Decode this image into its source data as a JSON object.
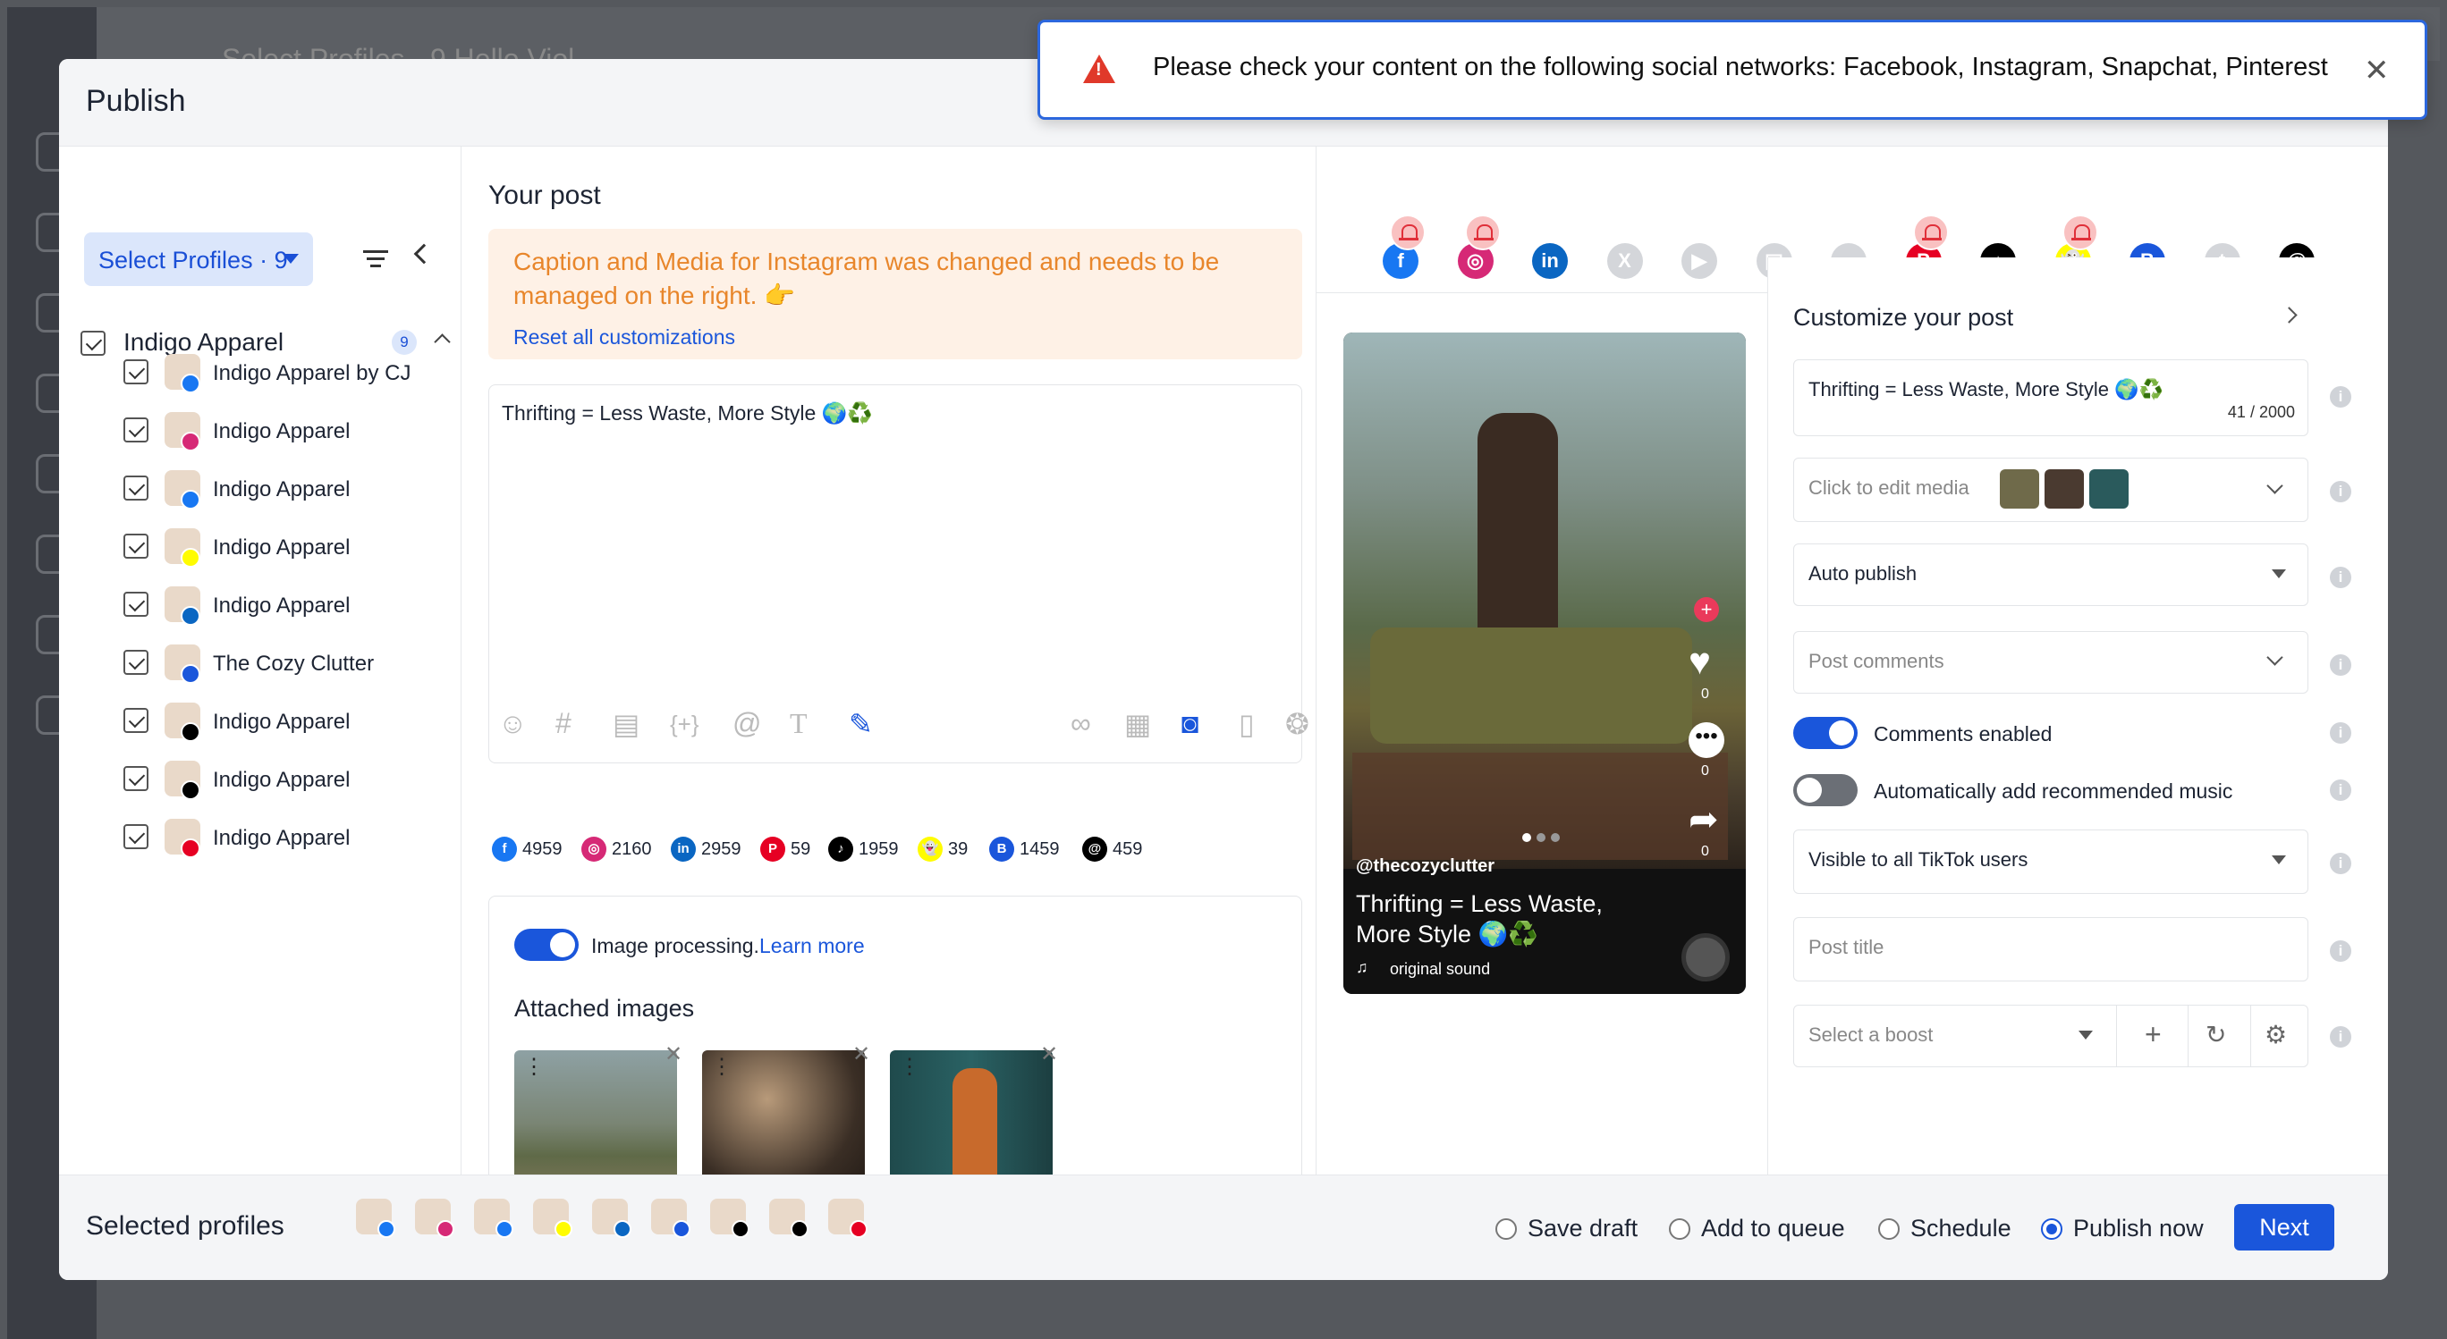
{
  "background": {
    "top_note": "Select Profiles · 9   Hello Viol"
  },
  "modal": {
    "title": "Publish"
  },
  "toast": {
    "message": "Please check your content on the following social networks: Facebook, Instagram, Snapchat, Pinterest",
    "close": "✕"
  },
  "left": {
    "select_profiles": "Select Profiles · 9",
    "group": {
      "name": "Indigo Apparel",
      "count": "9"
    },
    "profiles": [
      {
        "label": "Indigo Apparel by CJ",
        "network": "facebook",
        "color": "#1877f2"
      },
      {
        "label": "Indigo Apparel",
        "network": "instagram",
        "color": "#d62976"
      },
      {
        "label": "Indigo Apparel",
        "network": "facebook",
        "color": "#1877f2"
      },
      {
        "label": "Indigo Apparel",
        "network": "snapchat",
        "color": "#fffc00"
      },
      {
        "label": "Indigo Apparel",
        "network": "linkedin",
        "color": "#0a66c2"
      },
      {
        "label": "The Cozy Clutter",
        "network": "google-business",
        "color": "#1a56db"
      },
      {
        "label": "Indigo Apparel",
        "network": "threads",
        "color": "#000000"
      },
      {
        "label": "Indigo Apparel",
        "network": "tiktok",
        "color": "#000000"
      },
      {
        "label": "Indigo Apparel",
        "network": "pinterest",
        "color": "#e60023"
      }
    ]
  },
  "center": {
    "heading": "Your post",
    "warning": "Caption and Media for Instagram was changed and needs to be managed on the right. 👉",
    "reset": "Reset all customizations",
    "post_text": "Thrifting = Less Waste, More Style 🌍♻️",
    "counts": [
      {
        "network": "facebook",
        "glyph": "f",
        "color": "#1877f2",
        "value": "4959"
      },
      {
        "network": "instagram",
        "glyph": "◎",
        "color": "#d62976",
        "value": "2160"
      },
      {
        "network": "linkedin",
        "glyph": "in",
        "color": "#0a66c2",
        "value": "2959"
      },
      {
        "network": "pinterest",
        "glyph": "P",
        "color": "#e60023",
        "value": "59"
      },
      {
        "network": "tiktok",
        "glyph": "♪",
        "color": "#000000",
        "value": "1959"
      },
      {
        "network": "snapchat",
        "glyph": "👻",
        "color": "#fffc00",
        "value": "39"
      },
      {
        "network": "google-business",
        "glyph": "B",
        "color": "#1a56db",
        "value": "1459"
      },
      {
        "network": "threads",
        "glyph": "@",
        "color": "#000000",
        "value": "459"
      }
    ],
    "image_processing": "Image processing.",
    "learn_more": "Learn more",
    "attached_images": "Attached images"
  },
  "networks_bar": [
    {
      "name": "facebook",
      "glyph": "f",
      "color": "#1877f2",
      "alert": true
    },
    {
      "name": "instagram",
      "glyph": "◎",
      "color": "#d62976",
      "alert": true
    },
    {
      "name": "linkedin",
      "glyph": "in",
      "color": "#0a66c2",
      "alert": false
    },
    {
      "name": "x",
      "glyph": "X",
      "color": "#d4d6da",
      "alert": false
    },
    {
      "name": "youtube",
      "glyph": "▶",
      "color": "#d4d6da",
      "alert": false
    },
    {
      "name": "google-my-business",
      "glyph": "▤",
      "color": "#d4d6da",
      "alert": false
    },
    {
      "name": "reddit",
      "glyph": "●",
      "color": "#d4d6da",
      "alert": false
    },
    {
      "name": "pinterest",
      "glyph": "P",
      "color": "#e60023",
      "alert": true
    },
    {
      "name": "tiktok",
      "glyph": "♪",
      "color": "#000000",
      "alert": false
    },
    {
      "name": "snapchat",
      "glyph": "👻",
      "color": "#fffc00",
      "alert": true
    },
    {
      "name": "google-business",
      "glyph": "B",
      "color": "#1a56db",
      "alert": false
    },
    {
      "name": "tumblr",
      "glyph": "t",
      "color": "#d4d6da",
      "alert": false
    },
    {
      "name": "threads",
      "glyph": "@",
      "color": "#000000",
      "alert": false
    }
  ],
  "preview": {
    "handle": "@thecozyclutter",
    "caption": "Thrifting = Less Waste, More Style 🌍♻️",
    "sound": "original sound",
    "likes": "0",
    "comments": "0",
    "shares": "0"
  },
  "customize": {
    "title": "Customize your post",
    "caption": "Thrifting = Less Waste, More Style 🌍♻️",
    "char_count": "41 / 2000",
    "media": "Click to edit media",
    "auto_publish": "Auto publish",
    "post_comments": "Post comments",
    "comments_enabled": "Comments enabled",
    "music": "Automatically add recommended music",
    "visibility": "Visible to all TikTok users",
    "post_title": "Post title",
    "boost": "Select a boost"
  },
  "footer": {
    "selected_profiles": "Selected profiles",
    "options": [
      "Save draft",
      "Add to queue",
      "Schedule",
      "Publish now"
    ],
    "selected_option": "Publish now",
    "next": "Next"
  }
}
